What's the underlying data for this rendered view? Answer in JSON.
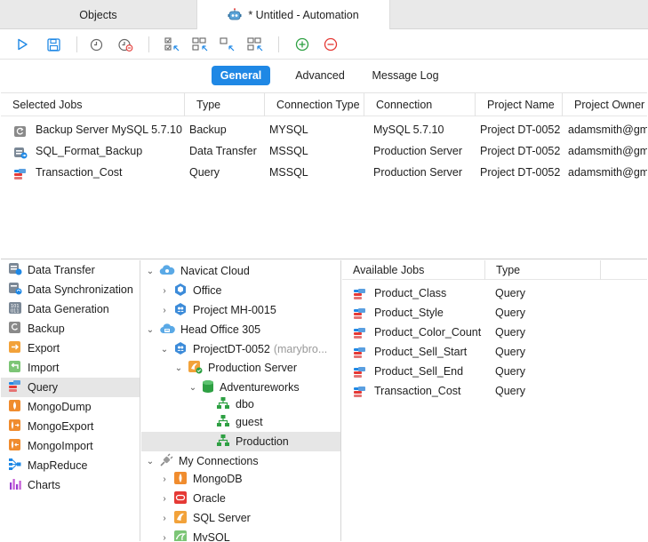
{
  "tabs": {
    "objects": "Objects",
    "automation": "* Untitled - Automation"
  },
  "toolbar": {
    "icons": [
      "run-icon",
      "save-icon",
      "schedule-icon",
      "remove-schedule-icon",
      "select-all-icon",
      "deselect-all-icon",
      "select-icon",
      "deselect-icon",
      "add-icon",
      "remove-icon"
    ]
  },
  "segments": {
    "general": "General",
    "advanced": "Advanced",
    "message_log": "Message Log"
  },
  "selected_jobs": {
    "columns": [
      "Selected Jobs",
      "Type",
      "Connection Type",
      "Connection",
      "Project Name",
      "Project Owner N"
    ],
    "rows": [
      {
        "name": "Backup Server MySQL 5.7.10",
        "type": "Backup",
        "conn_type": "MYSQL",
        "connection": "MySQL 5.7.10",
        "project": "Project DT-0052",
        "owner": "adamsmith@gm"
      },
      {
        "name": "SQL_Format_Backup",
        "type": "Data Transfer",
        "conn_type": "MSSQL",
        "connection": "Production Server",
        "project": "Project DT-0052",
        "owner": "adamsmith@gm"
      },
      {
        "name": "Transaction_Cost",
        "type": "Query",
        "conn_type": "MSSQL",
        "connection": "Production Server",
        "project": "Project DT-0052",
        "owner": "adamsmith@gm"
      }
    ]
  },
  "categories": [
    "Data Transfer",
    "Data Synchronization",
    "Data Generation",
    "Backup",
    "Export",
    "Import",
    "Query",
    "MongoDump",
    "MongoExport",
    "MongoImport",
    "MapReduce",
    "Charts"
  ],
  "selected_category": "Query",
  "tree": {
    "navicat_cloud": "Navicat Cloud",
    "office": "Office",
    "project_mh": "Project MH-0015",
    "head_office": "Head Office 305",
    "project_dt": "ProjectDT-0052",
    "project_dt_owner": "(marybro...",
    "production_server": "Production Server",
    "adventureworks": "Adventureworks",
    "dbo": "dbo",
    "guest": "guest",
    "production": "Production",
    "my_connections": "My Connections",
    "mongodb": "MongoDB",
    "oracle": "Oracle",
    "sql_server": "SQL Server",
    "mysql": "MySQL"
  },
  "available_jobs": {
    "columns": [
      "Available Jobs",
      "Type"
    ],
    "rows": [
      {
        "name": "Product_Class",
        "type": "Query"
      },
      {
        "name": "Product_Style",
        "type": "Query"
      },
      {
        "name": "Product_Color_Count",
        "type": "Query"
      },
      {
        "name": "Product_Sell_Start",
        "type": "Query"
      },
      {
        "name": "Product_Sell_End",
        "type": "Query"
      },
      {
        "name": "Transaction_Cost",
        "type": "Query"
      }
    ]
  },
  "colors": {
    "accent": "#1f88e5",
    "add_green": "#2ea043",
    "remove_red": "#e53935",
    "selection": "#e6e6e6"
  }
}
